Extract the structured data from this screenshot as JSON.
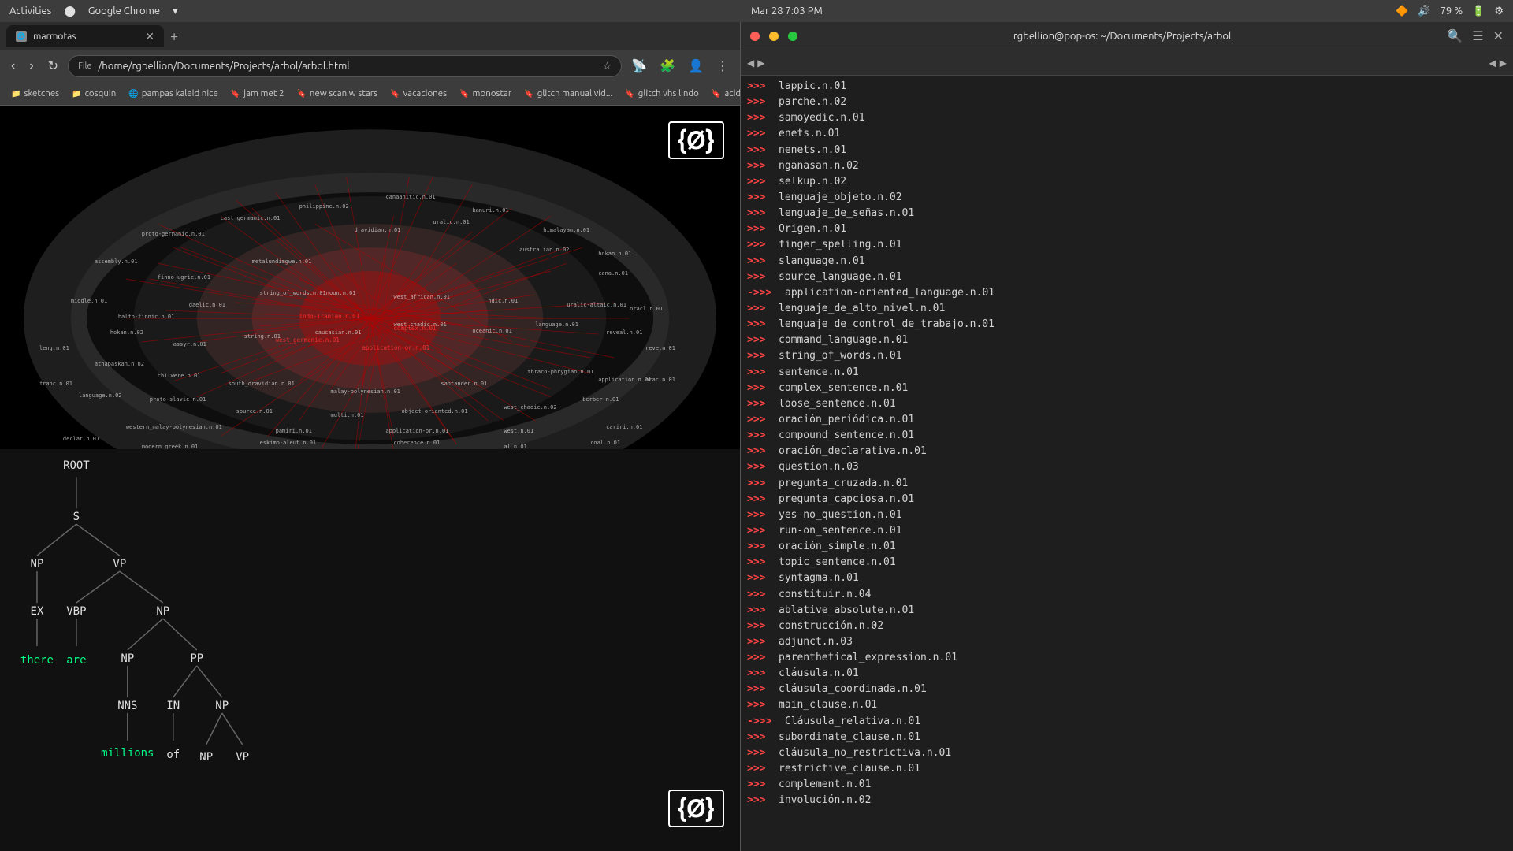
{
  "system_bar": {
    "activities": "Activities",
    "app_name": "Google Chrome",
    "datetime": "Mar 28  7:03 PM",
    "battery": "79 %"
  },
  "browser": {
    "tab": {
      "title": "marmotas",
      "favicon": "🌐"
    },
    "address": "/home/rgbellion/Documents/Projects/arbol/arbol.html",
    "address_protocol": "File",
    "bookmarks": [
      {
        "label": "sketches",
        "icon": "📁"
      },
      {
        "label": "cosquin",
        "icon": "📁"
      },
      {
        "label": "pampas kaleid nice",
        "icon": "🌐"
      },
      {
        "label": "jam met 2",
        "icon": "🔖"
      },
      {
        "label": "new scan w stars",
        "icon": "🔖"
      },
      {
        "label": "vacaciones",
        "icon": "🔖"
      },
      {
        "label": "monostar",
        "icon": "🔖"
      },
      {
        "label": "glitch manual vid...",
        "icon": "🔖"
      },
      {
        "label": "glitch vhs lindo",
        "icon": "🔖"
      },
      {
        "label": "acid",
        "icon": "🔖"
      }
    ],
    "empty_set_symbol": "{Ø}",
    "parse_tree": {
      "root": "ROOT",
      "nodes": [
        "S",
        "NP",
        "VP",
        "EX",
        "VBP",
        "NP",
        "NP",
        "PP",
        "NNS",
        "IN",
        "NP",
        "VP"
      ],
      "words": [
        "there",
        "are",
        "millions",
        "of"
      ]
    }
  },
  "terminal": {
    "title": "rgbellion@pop-os: ~/Documents/Projects/arbol",
    "lines": [
      "lappic.n.01",
      "parche.n.02",
      "samoyedic.n.01",
      "enets.n.01",
      "nenets.n.01",
      "nganasan.n.02",
      "selkup.n.02",
      "lenguaje_objeto.n.02",
      "lenguaje_de_señas.n.01",
      "Origen.n.01",
      "finger_spelling.n.01",
      "slanguage.n.01",
      "source_language.n.01",
      "application-oriented_language.n.01",
      "lenguaje_de_alto_nivel.n.01",
      "lenguaje_de_control_de_trabajo.n.01",
      "command_language.n.01",
      "string_of_words.n.01",
      "sentence.n.01",
      "complex_sentence.n.01",
      "loose_sentence.n.01",
      "oración_periódica.n.01",
      "compound_sentence.n.01",
      "oración_declarativa.n.01",
      "question.n.03",
      "pregunta_cruzada.n.01",
      "pregunta_capciosa.n.01",
      "yes-no_question.n.01",
      "run-on_sentence.n.01",
      "oración_simple.n.01",
      "topic_sentence.n.01",
      "syntagma.n.01",
      "constituir.n.04",
      "ablative_absolute.n.01",
      "construcción.n.02",
      "adjunct.n.03",
      "parenthetical_expression.n.01",
      "cláusula.n.01",
      "cláusula_coordinada.n.01",
      "main_clause.n.01",
      "Cláusula_relativa.n.01",
      "subordinate_clause.n.01",
      "cláusula_no_restrictiva.n.01",
      "restrictive_clause.n.01",
      "complement.n.01",
      "involución.n.02"
    ],
    "prompt": ">>>",
    "arrow_prompt": "--->>>"
  }
}
